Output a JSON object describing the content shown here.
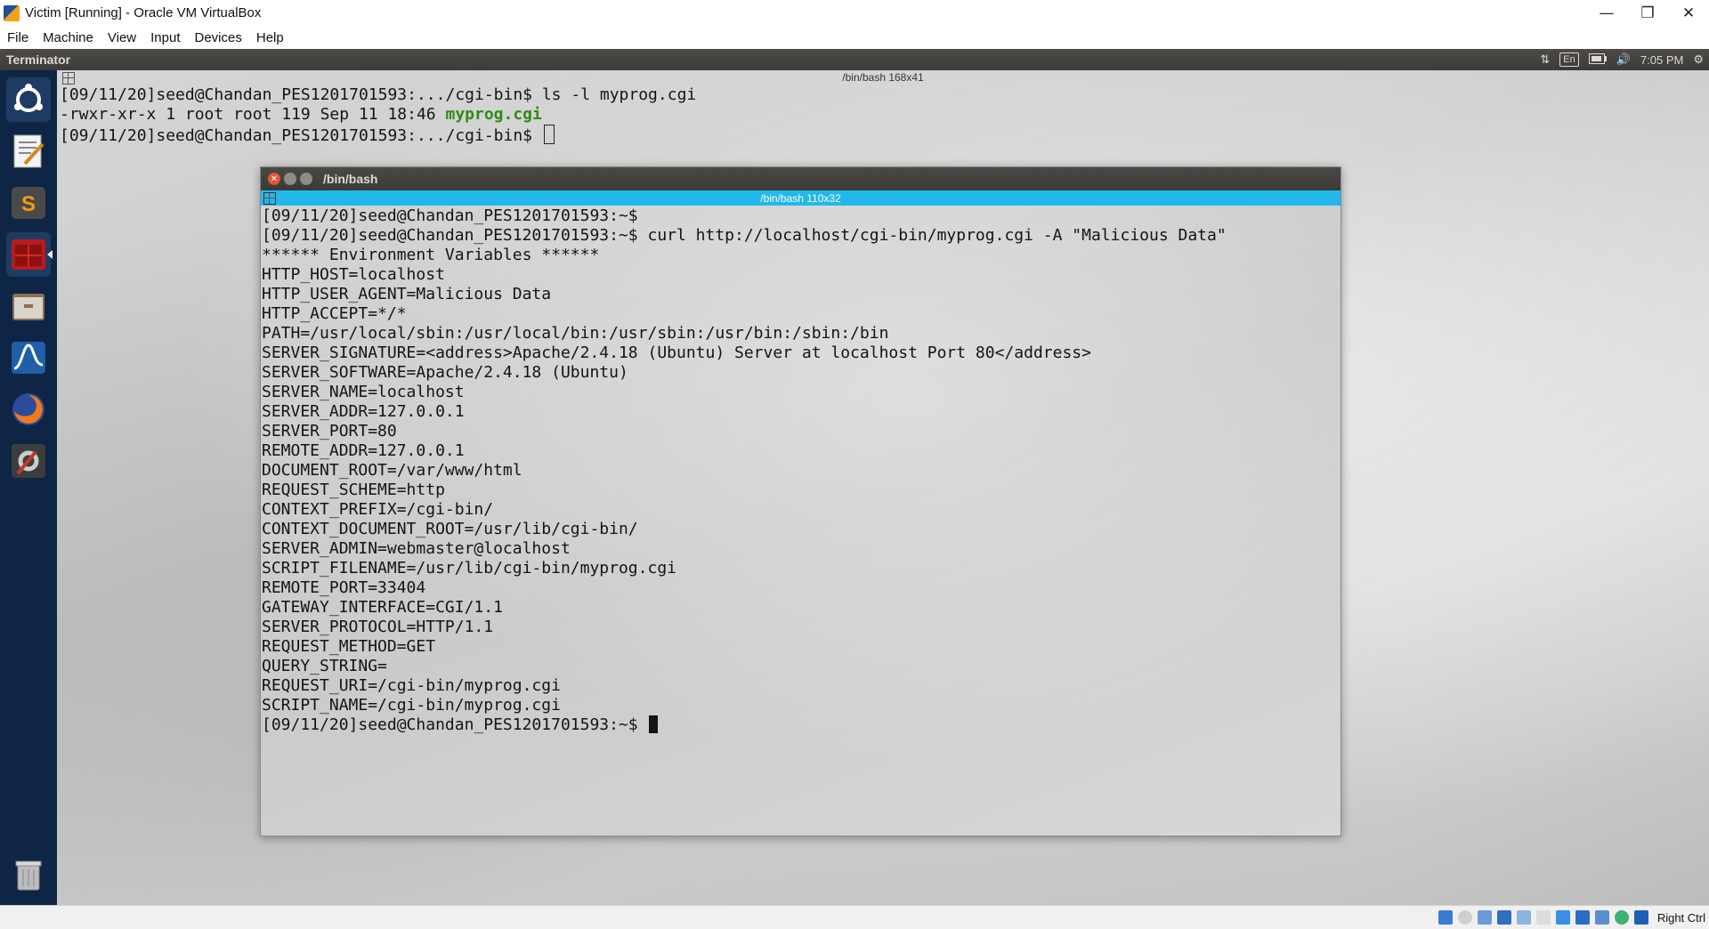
{
  "host": {
    "title": "Victim [Running] - Oracle VM VirtualBox",
    "menu": [
      "File",
      "Machine",
      "View",
      "Input",
      "Devices",
      "Help"
    ],
    "window_controls": {
      "minimize": "—",
      "restore": "❐",
      "close": "✕"
    },
    "host_key_label": "Right Ctrl"
  },
  "guest_panel": {
    "app_name": "Terminator",
    "keyboard_layout": "En",
    "time": "7:05 PM"
  },
  "back_terminal": {
    "title": "/bin/bash 168x41",
    "lines": [
      "[09/11/20]seed@Chandan_PES1201701593:.../cgi-bin$ ls -l myprog.cgi",
      "-rwxr-xr-x 1 root root 119 Sep 11 18:46 ",
      "[09/11/20]seed@Chandan_PES1201701593:.../cgi-bin$ "
    ],
    "highlighted_file": "myprog.cgi"
  },
  "front_terminal": {
    "window_title": "/bin/bash",
    "tab_title": "/bin/bash 110x32",
    "lines": [
      "[09/11/20]seed@Chandan_PES1201701593:~$",
      "[09/11/20]seed@Chandan_PES1201701593:~$ curl http://localhost/cgi-bin/myprog.cgi -A \"Malicious Data\"",
      "****** Environment Variables ******",
      "HTTP_HOST=localhost",
      "HTTP_USER_AGENT=Malicious Data",
      "HTTP_ACCEPT=*/*",
      "PATH=/usr/local/sbin:/usr/local/bin:/usr/sbin:/usr/bin:/sbin:/bin",
      "SERVER_SIGNATURE=<address>Apache/2.4.18 (Ubuntu) Server at localhost Port 80</address>",
      "SERVER_SOFTWARE=Apache/2.4.18 (Ubuntu)",
      "SERVER_NAME=localhost",
      "SERVER_ADDR=127.0.0.1",
      "SERVER_PORT=80",
      "REMOTE_ADDR=127.0.0.1",
      "DOCUMENT_ROOT=/var/www/html",
      "REQUEST_SCHEME=http",
      "CONTEXT_PREFIX=/cgi-bin/",
      "CONTEXT_DOCUMENT_ROOT=/usr/lib/cgi-bin/",
      "SERVER_ADMIN=webmaster@localhost",
      "SCRIPT_FILENAME=/usr/lib/cgi-bin/myprog.cgi",
      "REMOTE_PORT=33404",
      "GATEWAY_INTERFACE=CGI/1.1",
      "SERVER_PROTOCOL=HTTP/1.1",
      "REQUEST_METHOD=GET",
      "QUERY_STRING=",
      "REQUEST_URI=/cgi-bin/myprog.cgi",
      "SCRIPT_NAME=/cgi-bin/myprog.cgi",
      "[09/11/20]seed@Chandan_PES1201701593:~$ "
    ]
  },
  "launcher_items": [
    "ubuntu-dash-icon",
    "text-editor-icon",
    "sublime-text-icon",
    "terminator-icon",
    "files-icon",
    "wireshark-icon",
    "firefox-icon",
    "settings-icon",
    "trash-icon"
  ],
  "colors": {
    "launcher_bg": "#0e2545",
    "panel_bg": "#3c3b37",
    "tab_active": "#22b8ea",
    "filename_green": "#2f8b17"
  }
}
